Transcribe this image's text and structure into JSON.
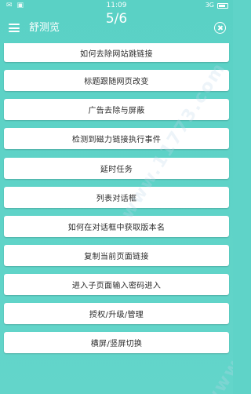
{
  "status_bar": {
    "time": "11:09",
    "left_icons": [
      "notification-icon",
      "card-icon"
    ],
    "right_text": "3G",
    "battery_icon": "battery-icon"
  },
  "header": {
    "menu_icon": "menu-icon",
    "app_title": "舒测览",
    "page_indicator": "5/6",
    "close_icon": "close-circle-icon"
  },
  "menu_items": [
    {
      "label": "如何去除网站跳链接"
    },
    {
      "label": "标题跟随网页改变"
    },
    {
      "label": "广告去除与屏蔽"
    },
    {
      "label": "检测到磁力链接执行事件"
    },
    {
      "label": "延时任务"
    },
    {
      "label": "列表对话框"
    },
    {
      "label": "如何在对话框中获取版本名"
    },
    {
      "label": "复制当前页面链接"
    },
    {
      "label": "进入子页面输入密码进入"
    },
    {
      "label": "授权/升级/管理"
    },
    {
      "label": "横屏/竖屏切换"
    }
  ],
  "watermark": {
    "text": "www.11773.com"
  },
  "colors": {
    "background": "#5fd3c8",
    "card": "#ffffff",
    "text": "#2b2b2b"
  }
}
